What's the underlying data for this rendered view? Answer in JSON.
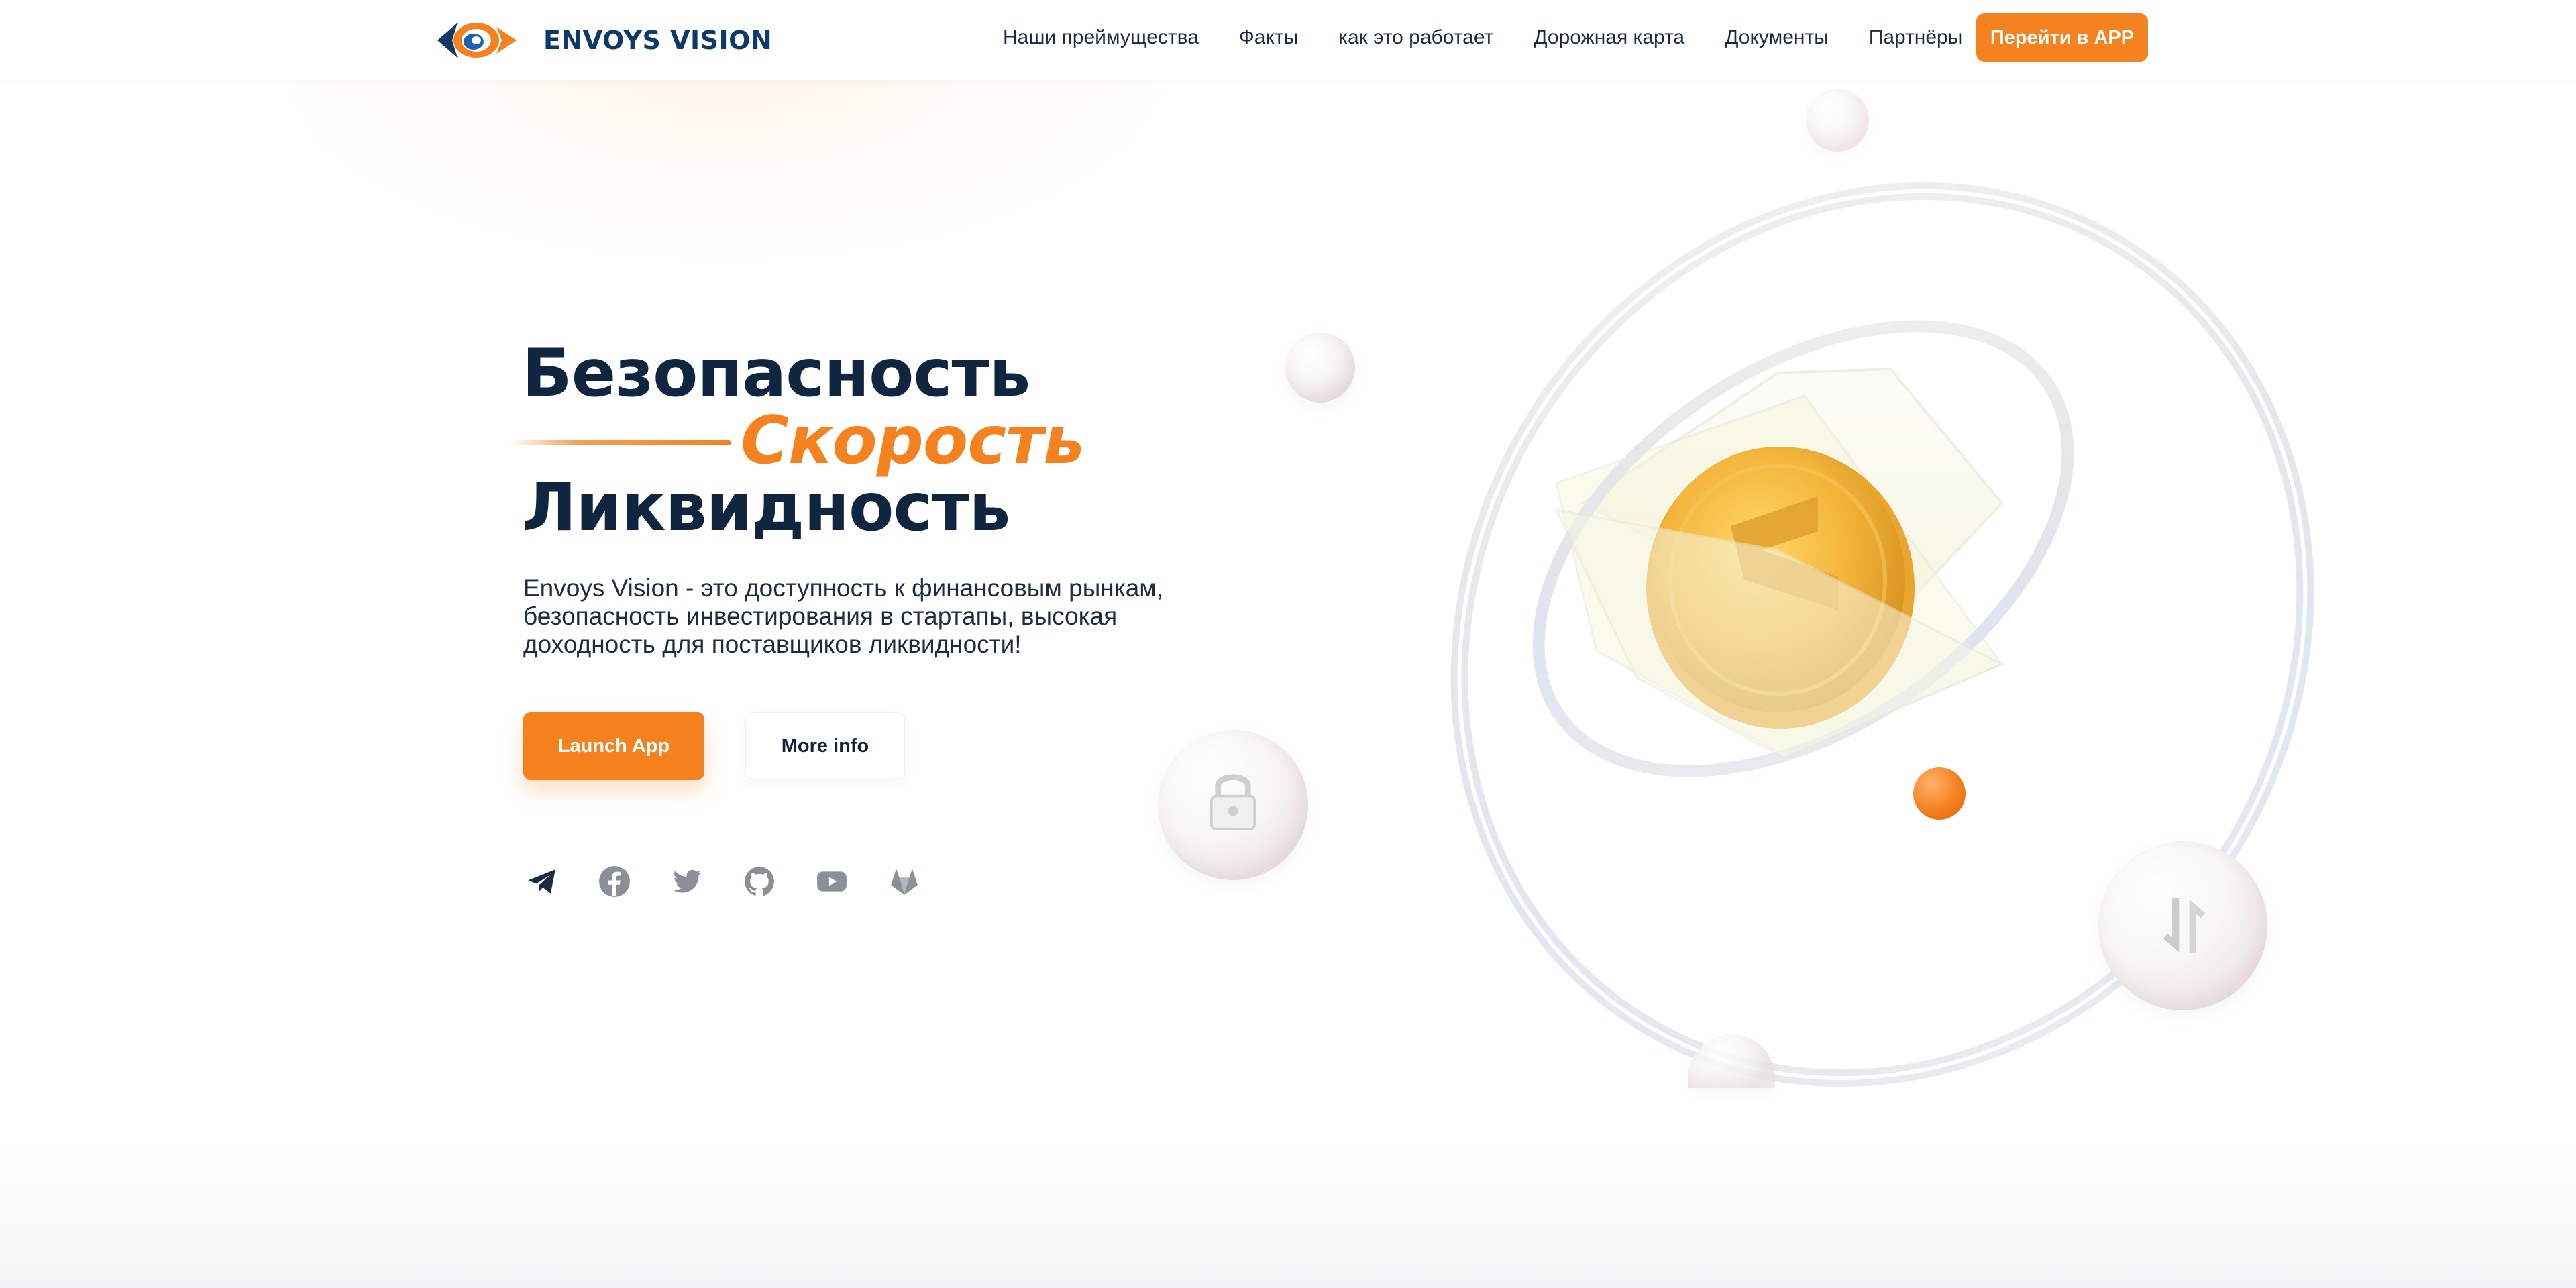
{
  "header": {
    "logo_text": "ENVOYS VISION",
    "nav": [
      {
        "label": "Наши преймущества"
      },
      {
        "label": "Факты"
      },
      {
        "label": "как это работает"
      },
      {
        "label": "Дорожная карта"
      },
      {
        "label": "Документы"
      },
      {
        "label": "Партнёры"
      }
    ],
    "cta_label": "Перейти в APP"
  },
  "hero": {
    "title_line1": "Безопасность",
    "title_line2": "Скорость",
    "title_line3": "Ликвидность",
    "description": "Envoys Vision - это доступность к финансовым рынкам, безопасность инвестирования в стартапы, высокая доходность для поставщиков ликвидности!",
    "launch_label": "Launch App",
    "more_label": "More info"
  },
  "socials": [
    {
      "icon": "telegram-icon"
    },
    {
      "icon": "facebook-icon"
    },
    {
      "icon": "twitter-icon"
    },
    {
      "icon": "github-icon"
    },
    {
      "icon": "youtube-icon"
    },
    {
      "icon": "gitlab-icon"
    }
  ],
  "colors": {
    "accent": "#f5811f",
    "navy": "#0f2540",
    "logo_blue": "#0e3a6b",
    "social_gray": "#8a8f98"
  }
}
